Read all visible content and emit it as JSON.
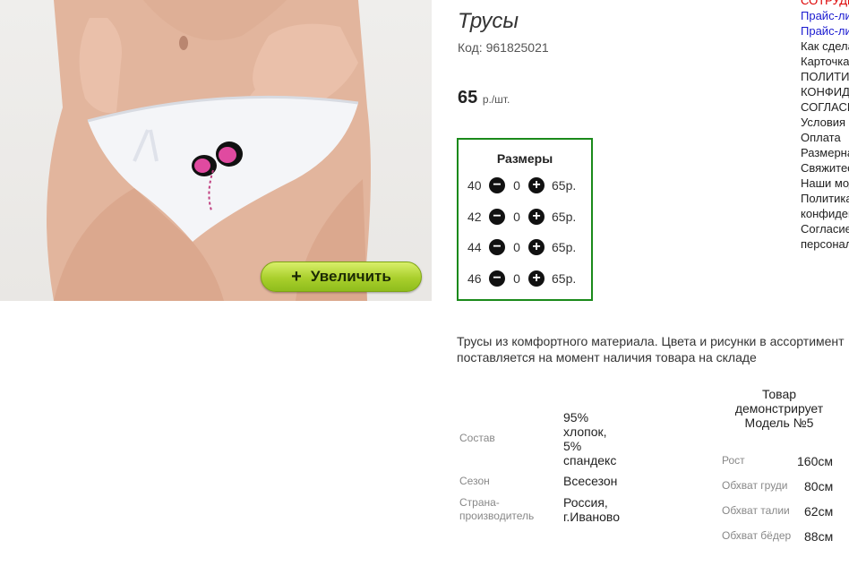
{
  "product": {
    "title": "Трусы",
    "code": "Код: 961825021",
    "price_value": "65",
    "price_unit": "р./шт.",
    "zoom_label": "Увеличить",
    "description": "Трусы из комфортного материала. Цвета и рисунки в ассортимент поставляется на момент наличия товара на складе"
  },
  "sizes": {
    "header": "Размеры",
    "rows": [
      {
        "size": "40",
        "qty": "0",
        "price": "65р."
      },
      {
        "size": "42",
        "qty": "0",
        "price": "65р."
      },
      {
        "size": "44",
        "qty": "0",
        "price": "65р."
      },
      {
        "size": "46",
        "qty": "0",
        "price": "65р."
      }
    ]
  },
  "specs": {
    "composition_label": "Состав",
    "composition_value": [
      "95%",
      "хлопок,",
      "5%",
      "спандекс"
    ],
    "season_label": "Сезон",
    "season_value": "Всесезон",
    "country_label": [
      "Страна-",
      "производитель"
    ],
    "country_value": [
      "Россия,",
      "г.Иваново"
    ]
  },
  "model": {
    "title": [
      "Товар",
      "демонстрирует",
      "Модель №5"
    ],
    "rows": [
      {
        "label": "Рост",
        "value": "160см"
      },
      {
        "label": "Обхват груди",
        "value": "80см"
      },
      {
        "label": "Обхват талии",
        "value": "62см"
      },
      {
        "label": "Обхват бёдер",
        "value": "88см"
      }
    ]
  },
  "sidebar": {
    "links": [
      {
        "text": "СОТРУДНИЧЕСТВО",
        "color": "red"
      },
      {
        "text": "Прайс-лист",
        "color": "blue"
      },
      {
        "text": "Прайс-лист",
        "color": "blue"
      },
      {
        "text": "Как сделать заказ",
        "color": "black"
      },
      {
        "text": "Карточка",
        "color": "black"
      },
      {
        "text": "ПОЛИТИКА",
        "color": "black"
      },
      {
        "text": "КОНФИДЕНЦИАЛЬНОСТИ",
        "color": "black"
      },
      {
        "text": "СОГЛАСИЕ",
        "color": "black"
      },
      {
        "text": "Условия",
        "color": "black"
      },
      {
        "text": "Оплата",
        "color": "black"
      },
      {
        "text": "Размерная сетка",
        "color": "black"
      },
      {
        "text": "Свяжитесь",
        "color": "black"
      },
      {
        "text": "Наши модели",
        "color": "black"
      },
      {
        "text": "Политика",
        "color": "black"
      },
      {
        "text": "конфиденциальности",
        "color": "black"
      },
      {
        "text": "Согласие",
        "color": "black"
      },
      {
        "text": "персональных",
        "color": "black"
      }
    ]
  },
  "colors": {
    "sizes_border": "#1a8a1a",
    "zoom_button": "#a9cf2c",
    "link_red": "#dd0000",
    "link_blue": "#1a1ad0"
  }
}
